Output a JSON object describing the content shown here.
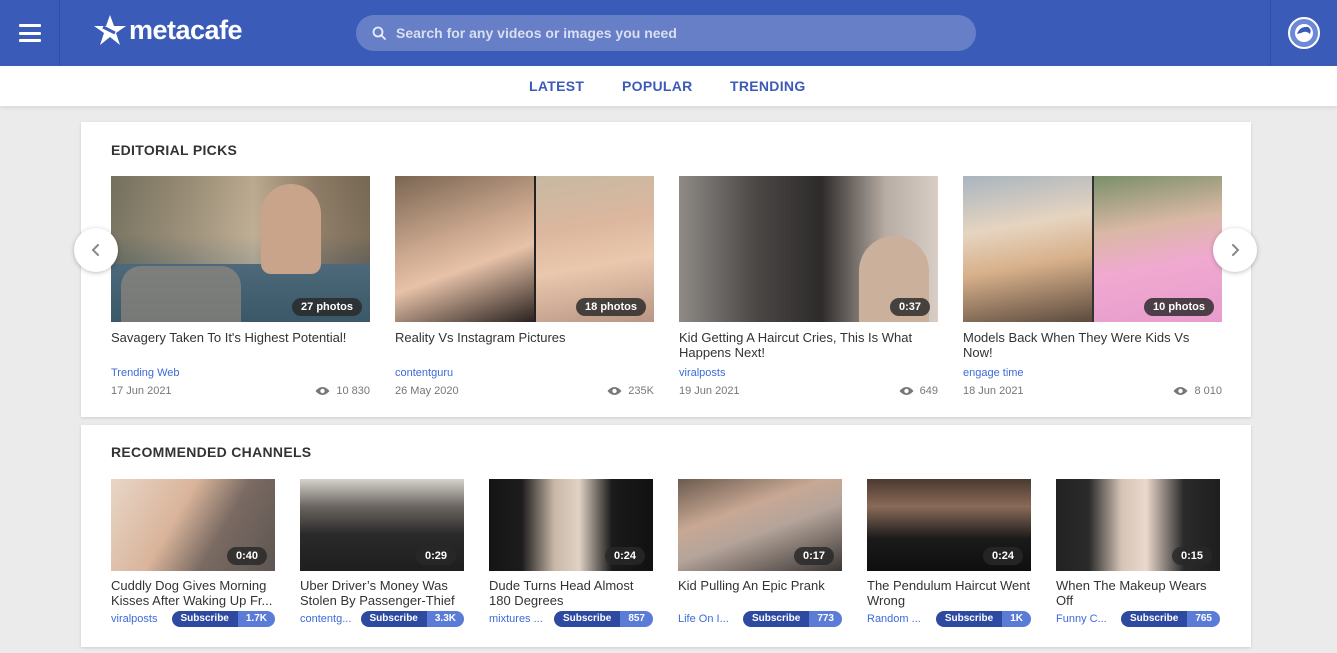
{
  "header": {
    "logo_text": "metacafe",
    "search_placeholder": "Search for any videos or images you need"
  },
  "nav": {
    "tabs": [
      "LATEST",
      "POPULAR",
      "TRENDING"
    ]
  },
  "editorial": {
    "title": "EDITORIAL PICKS",
    "cards": [
      {
        "title": "Savagery Taken To It's Highest Potential!",
        "source": "Trending Web",
        "date": "17 Jun 2021",
        "views": "10 830",
        "badge": "27 photos"
      },
      {
        "title": "Reality Vs Instagram Pictures",
        "source": "contentguru",
        "date": "26 May 2020",
        "views": "235K",
        "badge": "18 photos"
      },
      {
        "title": "Kid Getting A Haircut Cries, This Is What Happens Next!",
        "source": "viralposts",
        "date": "19 Jun 2021",
        "views": "649",
        "badge": "0:37"
      },
      {
        "title": "Models Back When They Were Kids Vs Now!",
        "source": "engage time",
        "date": "18 Jun 2021",
        "views": "8 010",
        "badge": "10 photos"
      }
    ]
  },
  "recommended": {
    "title": "RECOMMENDED CHANNELS",
    "subscribe_label": "Subscribe",
    "cards": [
      {
        "title": "Cuddly Dog Gives Morning Kisses After Waking Up Fr...",
        "source": "viralposts",
        "count": "1.7K",
        "duration": "0:40"
      },
      {
        "title": "Uber Driver’s Money Was Stolen By Passenger-Thief",
        "source": "contentg...",
        "count": "3.3K",
        "duration": "0:29"
      },
      {
        "title": "Dude Turns Head Almost 180 Degrees",
        "source": "mixtures ...",
        "count": "857",
        "duration": "0:24"
      },
      {
        "title": "Kid Pulling An Epic Prank",
        "source": "Life On I...",
        "count": "773",
        "duration": "0:17"
      },
      {
        "title": "The Pendulum Haircut Went Wrong",
        "source": "Random ...",
        "count": "1K",
        "duration": "0:24"
      },
      {
        "title": "When The Makeup Wears Off",
        "source": "Funny C...",
        "count": "765",
        "duration": "0:15"
      }
    ]
  },
  "colors": {
    "brand": "#3b5bb8",
    "link": "#3b6bd8",
    "background": "#ebebeb"
  }
}
